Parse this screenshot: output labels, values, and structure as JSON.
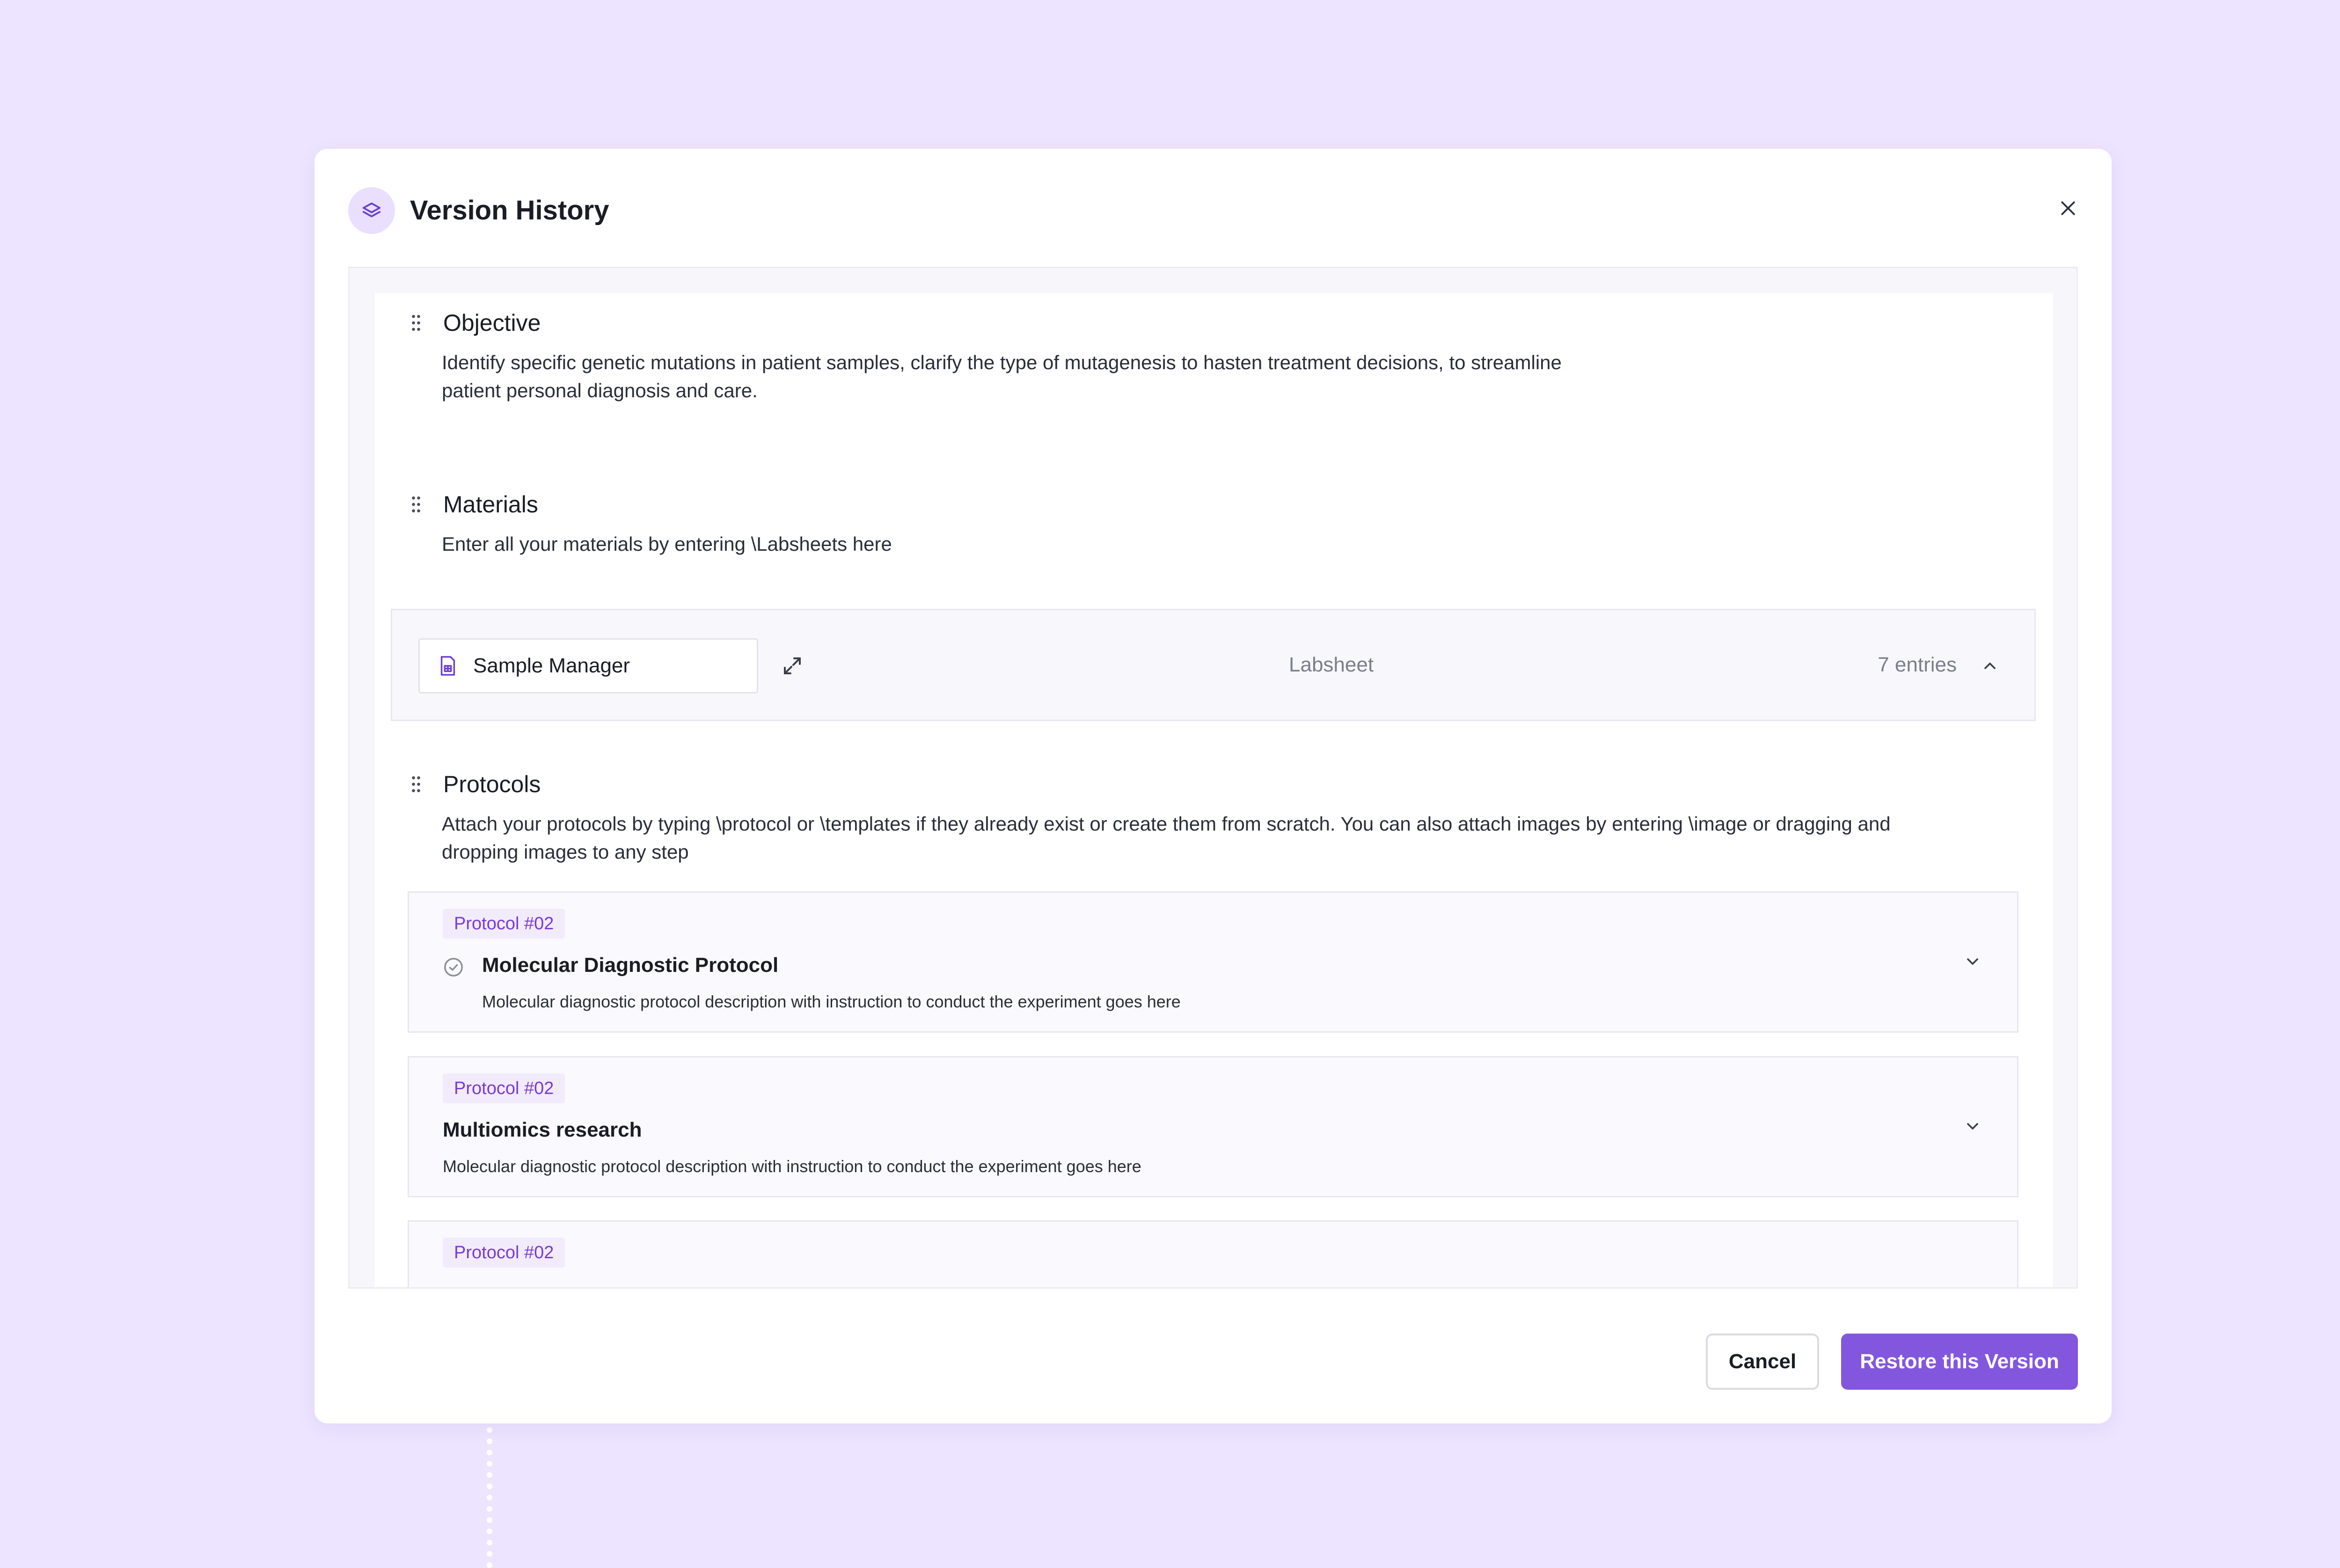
{
  "modal": {
    "title": "Version History",
    "icon": "layers-icon",
    "close_icon": "close-icon"
  },
  "sections": {
    "objective": {
      "title": "Objective",
      "description_line1": "Identify specific genetic mutations in patient samples, clarify the type of mutagenesis to hasten treatment decisions,  to streamline",
      "description_line2": "patient personal diagnosis and care."
    },
    "materials": {
      "title": "Materials",
      "description": "Enter all your materials by entering \\Labsheets here"
    },
    "protocols": {
      "title": "Protocols",
      "description_line1": "Attach your protocols by typing \\protocol or \\templates if they already exist or create them from scratch. You can also attach images by entering \\image or dragging and",
      "description_line2": "dropping images to any step"
    }
  },
  "labsheet": {
    "name": "Sample Manager",
    "type": "Labsheet",
    "entries": "7 entries",
    "icons": [
      "file-spreadsheet-icon",
      "expand-icon",
      "chevron-up-icon"
    ]
  },
  "protocol_cards": [
    {
      "badge": "Protocol #02",
      "title": "Molecular Diagnostic Protocol",
      "description": "Molecular diagnostic protocol description with instruction to conduct the experiment goes here",
      "status_icon": "check-circle-icon"
    },
    {
      "badge": "Protocol #02",
      "title": "Multiomics research",
      "description": "Molecular diagnostic protocol description with instruction to conduct the experiment goes here"
    },
    {
      "badge": "Protocol #02"
    }
  ],
  "footer": {
    "cancel_label": "Cancel",
    "restore_label": "Restore this Version"
  },
  "colors": {
    "background": "#EDE4FF",
    "accent": "#8357DD",
    "badge_text": "#7A3AD6",
    "badge_bg": "#F1EBFC"
  }
}
